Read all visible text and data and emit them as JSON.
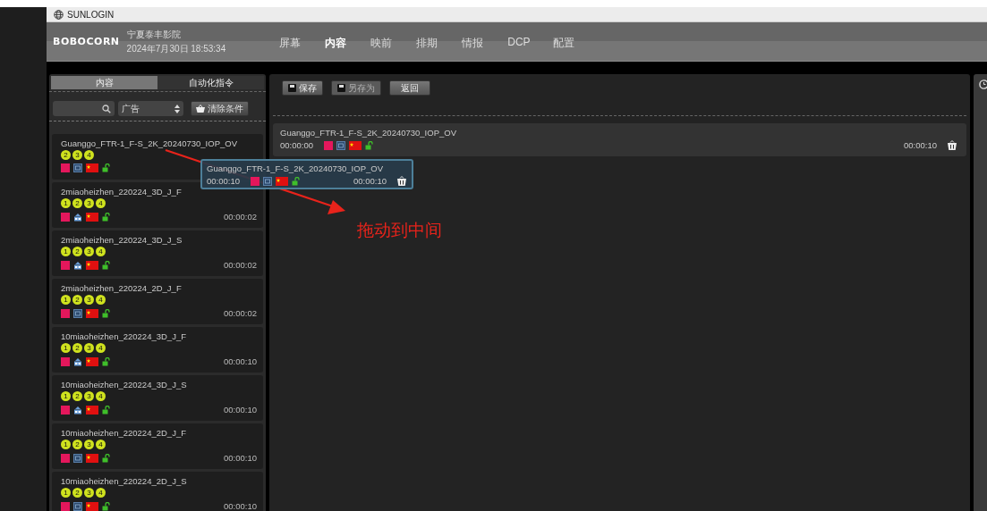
{
  "window": {
    "title": "SUNLOGIN"
  },
  "header": {
    "logo": "BOBOCORN",
    "cinema": "宁夏泰丰影院",
    "datetime": "2024年7月30日 18:53:34"
  },
  "nav": [
    {
      "label": "屏幕",
      "selected": false
    },
    {
      "label": "内容",
      "selected": true
    },
    {
      "label": "映前",
      "selected": false
    },
    {
      "label": "排期",
      "selected": false
    },
    {
      "label": "情报",
      "selected": false
    },
    {
      "label": "DCP",
      "selected": false
    },
    {
      "label": "配置",
      "selected": false
    }
  ],
  "library": {
    "tabs": [
      {
        "label": "内容",
        "selected": true
      },
      {
        "label": "自动化指令",
        "selected": false
      }
    ],
    "filter": {
      "value": "广告"
    },
    "clear_button": "清除条件",
    "items": [
      {
        "name": "Guanggo_FTR-1_F-S_2K_20240730_IOP_OV",
        "badges": [
          "2",
          "3",
          "4"
        ],
        "kind": "flat"
      },
      {
        "name": "2miaoheizhen_220224_3D_J_F",
        "badges": [
          "1",
          "2",
          "3",
          "4"
        ],
        "kind": "stereo",
        "duration": "00:00:02"
      },
      {
        "name": "2miaoheizhen_220224_3D_J_S",
        "badges": [
          "1",
          "2",
          "3",
          "4"
        ],
        "kind": "stereo",
        "duration": "00:00:02"
      },
      {
        "name": "2miaoheizhen_220224_2D_J_F",
        "badges": [
          "1",
          "2",
          "3",
          "4"
        ],
        "kind": "flat",
        "duration": "00:00:02"
      },
      {
        "name": "10miaoheizhen_220224_3D_J_F",
        "badges": [
          "1",
          "2",
          "3",
          "4"
        ],
        "kind": "stereo",
        "duration": "00:00:10"
      },
      {
        "name": "10miaoheizhen_220224_3D_J_S",
        "badges": [
          "1",
          "2",
          "3",
          "4"
        ],
        "kind": "stereo",
        "duration": "00:00:10"
      },
      {
        "name": "10miaoheizhen_220224_2D_J_F",
        "badges": [
          "1",
          "2",
          "3",
          "4"
        ],
        "kind": "flat",
        "duration": "00:00:10"
      },
      {
        "name": "10miaoheizhen_220224_2D_J_S",
        "badges": [
          "1",
          "2",
          "3",
          "4"
        ],
        "kind": "flat",
        "duration": "00:00:10"
      }
    ]
  },
  "editor": {
    "buttons": [
      {
        "label": "保存",
        "kind": "save",
        "disabled": false
      },
      {
        "label": "另存为",
        "kind": "save",
        "disabled": true
      },
      {
        "label": "返回",
        "kind": "plain",
        "disabled": false
      }
    ],
    "timeline": [
      {
        "name": "Guanggo_FTR-1_F-S_2K_20240730_IOP_OV",
        "start": "00:00:00",
        "kind": "flat",
        "duration": "00:00:10"
      }
    ]
  },
  "drag_ghost": {
    "name": "Guanggo_FTR-1_F-S_2K_20240730_IOP_OV",
    "start": "00:00:10",
    "kind": "flat",
    "duration": "00:00:10"
  },
  "annotation": {
    "text": "拖动到中间"
  }
}
